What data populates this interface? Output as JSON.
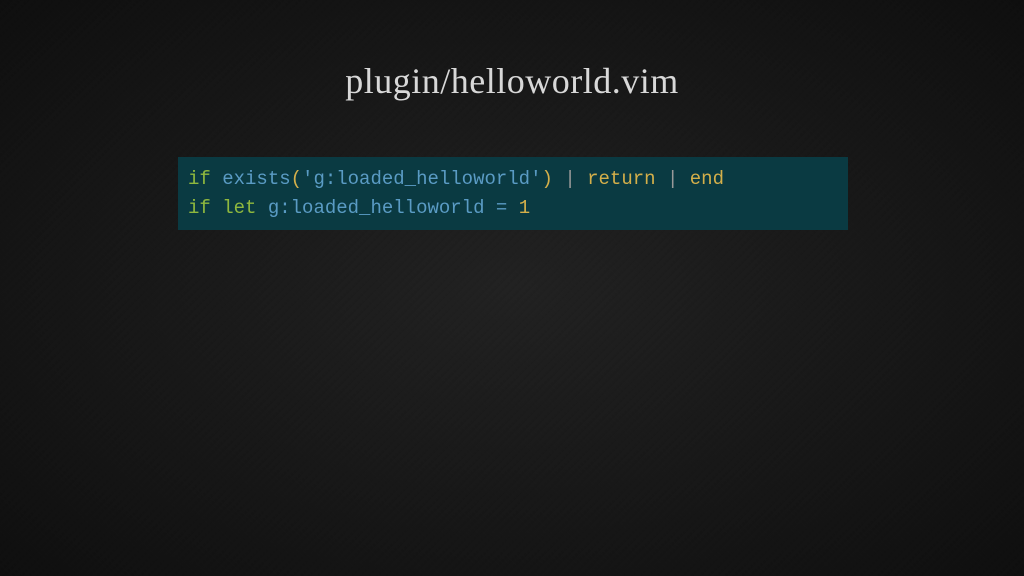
{
  "title": "plugin/helloworld.vim",
  "code": {
    "line1": {
      "if": "if",
      "exists": "exists",
      "lparen": "(",
      "string": "'g:loaded_helloworld'",
      "rparen": ")",
      "pipe1": "|",
      "return": "return",
      "pipe2": "|",
      "end": "end"
    },
    "line2": {
      "if": "if",
      "let": "let",
      "identifier": "g:loaded_helloworld",
      "eq": "=",
      "number": "1"
    }
  }
}
